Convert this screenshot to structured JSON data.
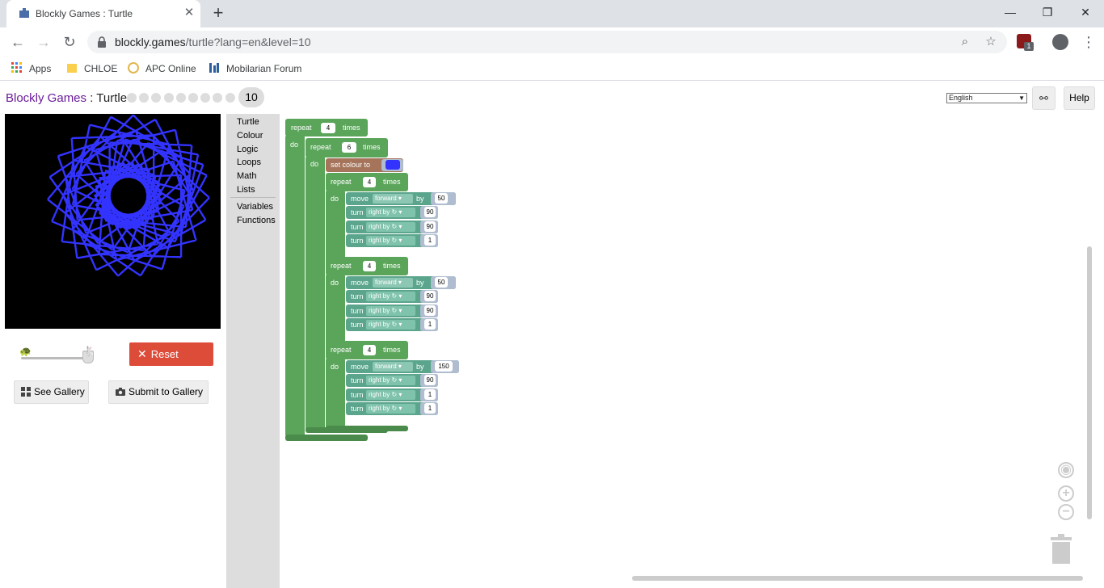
{
  "browser": {
    "tab_title": "Blockly Games : Turtle",
    "close_glyph": "✕",
    "new_tab_glyph": "+",
    "url_host": "blockly.games",
    "url_path": "/turtle?lang=en&level=10",
    "extension_badge": "1",
    "bookmarks": [
      "Apps",
      "CHLOE",
      "APC Online",
      "Mobilarian Forum"
    ]
  },
  "header": {
    "brand": "Blockly Games",
    "separator": " : ",
    "game": "Turtle",
    "level": "10",
    "language": "English",
    "help_label": "Help"
  },
  "controls": {
    "reset_label": "Reset",
    "see_gallery_label": "See Gallery",
    "submit_gallery_label": "Submit to Gallery"
  },
  "toolbox": [
    "Turtle",
    "Colour",
    "Logic",
    "Loops",
    "Math",
    "Lists",
    "Variables",
    "Functions"
  ],
  "program": {
    "outer_repeat": "4",
    "inner_repeat": "6",
    "set_colour_label": "set colour to",
    "colour": "#3333ff",
    "repeat_label": "repeat",
    "times_label": "times",
    "do_label": "do",
    "move_label": "move",
    "by_label": "by",
    "turn_label": "turn",
    "direction_forward": "forward ▾",
    "turn_right": "right by ↻ ▾",
    "groups": [
      {
        "repeat": "4",
        "move": "50",
        "turns": [
          "90",
          "90",
          "1"
        ]
      },
      {
        "repeat": "4",
        "move": "50",
        "turns": [
          "90",
          "90",
          "1"
        ]
      },
      {
        "repeat": "4",
        "move": "150",
        "turns": [
          "90",
          "1",
          "1"
        ]
      }
    ]
  }
}
